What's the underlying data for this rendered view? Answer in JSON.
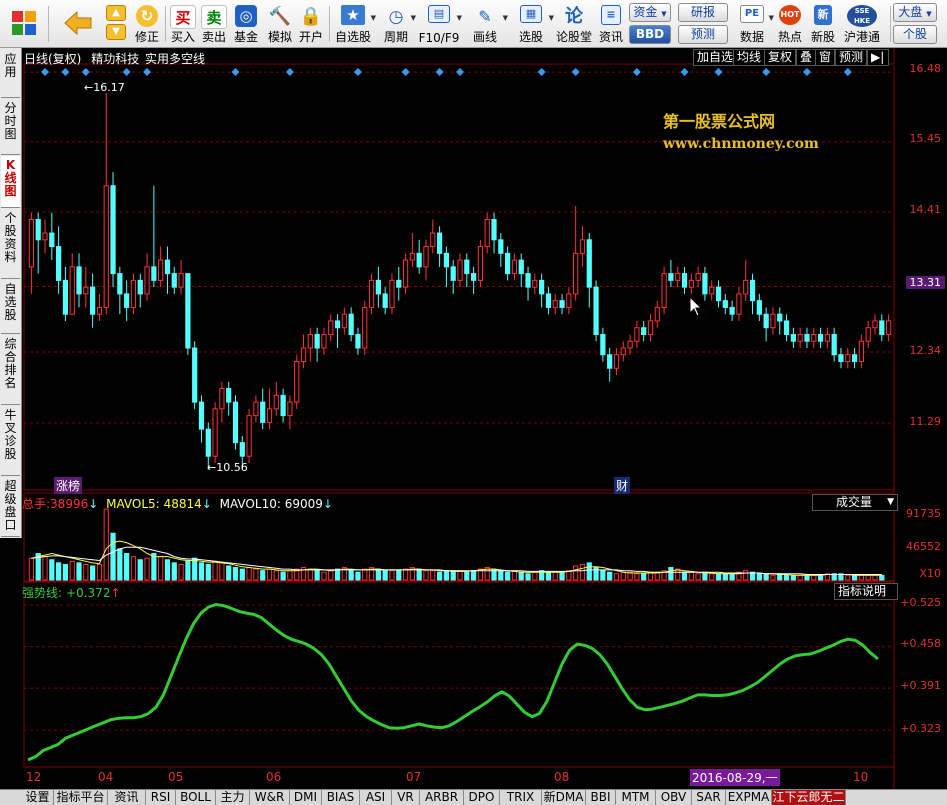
{
  "toolbar": {
    "buttons": [
      {
        "label": "",
        "icon": "app-grid-icon"
      },
      {
        "label": "",
        "icon": "back-arrow-icon"
      },
      {
        "label": "修正",
        "icon": "fix-icon"
      },
      {
        "label": "买入",
        "icon": "buy-icon",
        "glyph": "买"
      },
      {
        "label": "卖出",
        "icon": "sell-icon",
        "glyph": "卖"
      },
      {
        "label": "基金",
        "icon": "fund-icon"
      },
      {
        "label": "模拟",
        "icon": "hammer-icon"
      },
      {
        "label": "开户",
        "icon": "lock-icon"
      },
      {
        "label": "自选股",
        "icon": "star-icon"
      },
      {
        "label": "周期",
        "icon": "clock-icon"
      },
      {
        "label": "F10/F9",
        "icon": "f10-icon"
      },
      {
        "label": "画线",
        "icon": "pen-icon"
      },
      {
        "label": "选股",
        "icon": "screen-icon"
      },
      {
        "label": "论股堂",
        "icon": "forum-icon",
        "glyph": "论"
      },
      {
        "label": "资讯",
        "icon": "news-icon"
      },
      {
        "label": "数据",
        "icon": "pe-icon",
        "glyph": "PE"
      },
      {
        "label": "热点",
        "icon": "hot-icon",
        "glyph": "HOT"
      },
      {
        "label": "新股",
        "icon": "ipo-icon"
      },
      {
        "label": "沪港通",
        "icon": "sse-hke-icon",
        "glyph": "SSE HKE"
      }
    ],
    "small_buttons": {
      "capital": "资金",
      "bbd": "BBD",
      "research": "研报",
      "forecast": "预测",
      "market": "大盘",
      "stock": "个股"
    }
  },
  "left_tabs": [
    "应用",
    "分时图",
    "K线图",
    "个股资料",
    "自选股",
    "综合排名",
    "牛叉诊股",
    "超级盘口"
  ],
  "left_tabs_active": 2,
  "chart_header": {
    "period": "日线(复权)",
    "stock_name": "精功科技",
    "indicator_name": "实用多空线",
    "buttons": [
      "加自选",
      "均线",
      "复权",
      "叠",
      "窗",
      "预测",
      "▶|"
    ]
  },
  "watermark": {
    "line1": "第一股票公式网",
    "line2": "www.chnmoney.com"
  },
  "price_axis": {
    "labels": [
      "16.48",
      "15.45",
      "14.41",
      "13.31",
      "12.34",
      "11.29"
    ],
    "current": "13.31"
  },
  "annotations": {
    "high": "16.17",
    "low": "10.56",
    "tag_left": "涨榜",
    "tag_right": "财"
  },
  "volume_panel": {
    "total_label": "总手:",
    "total_value": "38996",
    "mavol5_label": "MAVOL5:",
    "mavol5_value": "48814",
    "mavol10_label": "MAVOL10:",
    "mavol10_value": "69009",
    "axis": [
      "91735",
      "46552",
      "X10"
    ],
    "dropdown": "成交量"
  },
  "strength_panel": {
    "label": "强势线:",
    "value": "+0.372",
    "axis": [
      "+0.525",
      "+0.458",
      "+0.391",
      "+0.323"
    ],
    "help_button": "指标说明"
  },
  "time_axis": {
    "labels": [
      "12",
      "04",
      "05",
      "06",
      "07",
      "08",
      "10"
    ],
    "cursor": "2016-08-29,一"
  },
  "bottom_tabs": [
    "设置",
    "指标平台",
    "资讯",
    "RSI",
    "BOLL",
    "主力",
    "W&R",
    "DMI",
    "BIAS",
    "ASI",
    "VR",
    "ARBR",
    "DPO",
    "TRIX",
    "新DMA",
    "BBI",
    "MTM",
    "OBV",
    "SAR",
    "EXPMA",
    "江下云郎无二"
  ],
  "colors": {
    "up": "#ff3232",
    "down": "#54ffff",
    "strength": "#33cc33",
    "grid": "#800000",
    "accent": "#e8c020"
  },
  "chart_data": {
    "type": "candlestick",
    "ylim": [
      10.3,
      16.6
    ],
    "candles": [
      [
        13.6,
        14.3,
        14.4,
        13.2
      ],
      [
        14.3,
        14.0,
        14.4,
        13.5
      ],
      [
        14.0,
        14.1,
        14.3,
        13.8
      ],
      [
        14.1,
        13.9,
        14.4,
        13.7
      ],
      [
        13.9,
        13.4,
        14.2,
        13.2
      ],
      [
        13.4,
        12.9,
        13.6,
        12.8
      ],
      [
        12.9,
        13.6,
        13.8,
        12.9
      ],
      [
        13.6,
        13.2,
        13.8,
        13.0
      ],
      [
        13.2,
        13.3,
        13.6,
        13.0
      ],
      [
        13.3,
        12.9,
        13.5,
        12.7
      ],
      [
        12.9,
        13.0,
        13.2,
        12.8
      ],
      [
        13.0,
        14.8,
        16.17,
        12.9
      ],
      [
        14.8,
        13.5,
        15.0,
        13.3
      ],
      [
        13.5,
        13.2,
        13.6,
        12.9
      ],
      [
        13.2,
        13.0,
        13.4,
        12.8
      ],
      [
        13.0,
        13.4,
        13.5,
        12.9
      ],
      [
        13.4,
        13.2,
        13.5,
        13.0
      ],
      [
        13.2,
        13.6,
        13.8,
        13.1
      ],
      [
        13.6,
        13.4,
        14.8,
        13.3
      ],
      [
        13.4,
        13.7,
        13.9,
        13.3
      ],
      [
        13.7,
        13.5,
        13.9,
        13.2
      ],
      [
        13.5,
        13.3,
        13.6,
        13.2
      ],
      [
        13.3,
        13.5,
        13.7,
        13.2
      ],
      [
        13.5,
        12.4,
        13.5,
        12.3
      ],
      [
        12.4,
        11.6,
        12.5,
        11.5
      ],
      [
        11.6,
        11.2,
        11.7,
        11.0
      ],
      [
        11.2,
        10.8,
        11.3,
        10.6
      ],
      [
        10.8,
        11.5,
        11.6,
        10.7
      ],
      [
        11.5,
        11.8,
        11.9,
        11.3
      ],
      [
        11.8,
        11.6,
        11.9,
        11.4
      ],
      [
        11.6,
        11.0,
        11.7,
        10.9
      ],
      [
        11.0,
        10.8,
        11.1,
        10.6
      ],
      [
        10.8,
        11.4,
        11.5,
        10.7
      ],
      [
        11.4,
        11.6,
        11.7,
        11.3
      ],
      [
        11.6,
        11.3,
        11.8,
        11.2
      ],
      [
        11.3,
        11.5,
        11.8,
        11.2
      ],
      [
        11.5,
        11.7,
        11.9,
        11.4
      ],
      [
        11.7,
        11.4,
        11.8,
        11.3
      ],
      [
        11.4,
        11.6,
        11.7,
        11.2
      ],
      [
        11.6,
        12.2,
        12.3,
        11.5
      ],
      [
        12.2,
        12.4,
        12.6,
        12.1
      ],
      [
        12.4,
        12.6,
        12.7,
        12.2
      ],
      [
        12.6,
        12.4,
        12.7,
        12.2
      ],
      [
        12.4,
        12.6,
        12.7,
        12.3
      ],
      [
        12.6,
        12.8,
        12.9,
        12.5
      ],
      [
        12.8,
        12.7,
        12.9,
        12.4
      ],
      [
        12.7,
        12.9,
        13.0,
        12.6
      ],
      [
        12.9,
        12.6,
        13.0,
        12.5
      ],
      [
        12.6,
        12.4,
        12.7,
        12.3
      ],
      [
        12.4,
        13.0,
        13.1,
        12.3
      ],
      [
        13.0,
        13.4,
        13.5,
        12.9
      ],
      [
        13.4,
        13.2,
        13.6,
        13.0
      ],
      [
        13.2,
        13.0,
        13.3,
        12.9
      ],
      [
        13.0,
        13.4,
        13.5,
        12.9
      ],
      [
        13.4,
        13.3,
        13.6,
        13.1
      ],
      [
        13.3,
        13.7,
        13.8,
        13.2
      ],
      [
        13.7,
        13.8,
        14.1,
        13.6
      ],
      [
        13.8,
        13.6,
        14.0,
        13.5
      ],
      [
        13.6,
        13.9,
        14.0,
        13.4
      ],
      [
        13.9,
        14.1,
        14.3,
        13.8
      ],
      [
        14.1,
        13.8,
        14.2,
        13.6
      ],
      [
        13.8,
        13.6,
        13.9,
        13.3
      ],
      [
        13.6,
        13.4,
        13.7,
        13.2
      ],
      [
        13.4,
        13.7,
        13.8,
        13.3
      ],
      [
        13.7,
        13.5,
        13.8,
        13.3
      ],
      [
        13.5,
        13.4,
        13.6,
        13.2
      ],
      [
        13.4,
        13.9,
        14.0,
        13.3
      ],
      [
        13.9,
        14.3,
        14.4,
        13.8
      ],
      [
        14.3,
        14.0,
        14.4,
        13.8
      ],
      [
        14.0,
        13.8,
        14.1,
        13.6
      ],
      [
        13.8,
        13.5,
        13.9,
        13.4
      ],
      [
        13.5,
        13.7,
        13.8,
        13.4
      ],
      [
        13.7,
        13.5,
        13.8,
        13.3
      ],
      [
        13.5,
        13.3,
        13.6,
        13.1
      ],
      [
        13.3,
        13.4,
        13.5,
        13.2
      ],
      [
        13.4,
        13.2,
        13.5,
        13.0
      ],
      [
        13.2,
        13.0,
        13.3,
        12.9
      ],
      [
        13.0,
        13.1,
        13.2,
        12.9
      ],
      [
        13.1,
        13.0,
        13.2,
        12.9
      ],
      [
        13.0,
        13.2,
        13.3,
        12.9
      ],
      [
        13.2,
        13.8,
        14.5,
        13.1
      ],
      [
        13.8,
        14.0,
        14.2,
        13.6
      ],
      [
        14.0,
        13.3,
        14.1,
        13.0
      ],
      [
        13.3,
        12.6,
        13.4,
        12.5
      ],
      [
        12.6,
        12.3,
        12.7,
        12.2
      ],
      [
        12.3,
        12.1,
        12.4,
        11.9
      ],
      [
        12.1,
        12.3,
        12.4,
        12.0
      ],
      [
        12.3,
        12.4,
        12.5,
        12.2
      ],
      [
        12.4,
        12.5,
        12.6,
        12.3
      ],
      [
        12.5,
        12.7,
        12.8,
        12.4
      ],
      [
        12.7,
        12.6,
        12.8,
        12.5
      ],
      [
        12.6,
        12.8,
        12.9,
        12.5
      ],
      [
        12.8,
        13.0,
        13.1,
        12.7
      ],
      [
        13.0,
        13.5,
        13.6,
        12.9
      ],
      [
        13.5,
        13.4,
        13.7,
        13.3
      ],
      [
        13.4,
        13.5,
        13.6,
        13.3
      ],
      [
        13.5,
        13.3,
        13.6,
        13.2
      ],
      [
        13.3,
        13.4,
        13.5,
        13.2
      ],
      [
        13.4,
        13.5,
        13.6,
        13.3
      ],
      [
        13.5,
        13.2,
        13.6,
        13.1
      ],
      [
        13.2,
        13.3,
        13.4,
        13.1
      ],
      [
        13.3,
        13.1,
        13.4,
        13.0
      ],
      [
        13.1,
        13.0,
        13.2,
        12.9
      ],
      [
        13.0,
        12.9,
        13.1,
        12.8
      ],
      [
        12.9,
        13.2,
        13.3,
        12.8
      ],
      [
        13.2,
        13.4,
        13.7,
        13.1
      ],
      [
        13.4,
        13.1,
        13.5,
        12.9
      ],
      [
        13.1,
        12.9,
        13.2,
        12.8
      ],
      [
        12.9,
        12.7,
        13.0,
        12.5
      ],
      [
        12.7,
        12.9,
        13.0,
        12.6
      ],
      [
        12.9,
        12.8,
        13.0,
        12.6
      ],
      [
        12.8,
        12.6,
        12.9,
        12.5
      ],
      [
        12.6,
        12.5,
        12.7,
        12.4
      ],
      [
        12.5,
        12.6,
        12.7,
        12.4
      ],
      [
        12.6,
        12.5,
        12.7,
        12.4
      ],
      [
        12.5,
        12.6,
        12.7,
        12.4
      ],
      [
        12.6,
        12.5,
        12.7,
        12.4
      ],
      [
        12.5,
        12.6,
        12.7,
        12.4
      ],
      [
        12.6,
        12.3,
        12.7,
        12.2
      ],
      [
        12.3,
        12.2,
        12.4,
        12.1
      ],
      [
        12.2,
        12.3,
        12.4,
        12.1
      ],
      [
        12.3,
        12.2,
        12.4,
        12.1
      ],
      [
        12.2,
        12.5,
        12.6,
        12.1
      ],
      [
        12.5,
        12.7,
        12.8,
        12.4
      ],
      [
        12.7,
        12.8,
        12.9,
        12.6
      ],
      [
        12.8,
        12.6,
        12.9,
        12.5
      ],
      [
        12.6,
        12.8,
        12.9,
        12.5
      ]
    ],
    "strength_line": [
      0.275,
      0.28,
      0.29,
      0.295,
      0.3,
      0.31,
      0.315,
      0.32,
      0.325,
      0.33,
      0.335,
      0.34,
      0.342,
      0.343,
      0.343,
      0.345,
      0.35,
      0.36,
      0.38,
      0.41,
      0.44,
      0.47,
      0.495,
      0.512,
      0.522,
      0.526,
      0.524,
      0.52,
      0.515,
      0.512,
      0.51,
      0.505,
      0.495,
      0.485,
      0.476,
      0.47,
      0.466,
      0.462,
      0.455,
      0.445,
      0.43,
      0.41,
      0.39,
      0.37,
      0.355,
      0.345,
      0.338,
      0.332,
      0.327,
      0.326,
      0.327,
      0.33,
      0.333,
      0.33,
      0.328,
      0.327,
      0.33,
      0.337,
      0.345,
      0.353,
      0.36,
      0.368,
      0.378,
      0.385,
      0.378,
      0.365,
      0.352,
      0.345,
      0.35,
      0.37,
      0.4,
      0.43,
      0.452,
      0.462,
      0.46,
      0.455,
      0.445,
      0.43,
      0.41,
      0.39,
      0.372,
      0.36,
      0.356,
      0.357,
      0.36,
      0.363,
      0.366,
      0.37,
      0.375,
      0.38,
      0.38,
      0.379,
      0.379,
      0.38,
      0.383,
      0.387,
      0.393,
      0.4,
      0.41,
      0.42,
      0.43,
      0.438,
      0.443,
      0.445,
      0.446,
      0.45,
      0.455,
      0.46,
      0.466,
      0.47,
      0.468,
      0.46,
      0.448,
      0.438
    ],
    "volumes": [
      28,
      34,
      30,
      26,
      22,
      20,
      24,
      22,
      20,
      18,
      20,
      91,
      60,
      40,
      34,
      30,
      26,
      28,
      34,
      30,
      26,
      22,
      20,
      24,
      28,
      22,
      20,
      24,
      22,
      18,
      16,
      14,
      16,
      14,
      12,
      14,
      12,
      10,
      12,
      14,
      16,
      14,
      12,
      10,
      12,
      14,
      16,
      12,
      10,
      14,
      16,
      14,
      12,
      12,
      12,
      14,
      16,
      14,
      12,
      12,
      10,
      12,
      12,
      12,
      10,
      12,
      14,
      16,
      14,
      12,
      10,
      12,
      10,
      8,
      10,
      12,
      10,
      10,
      10,
      12,
      18,
      20,
      22,
      16,
      12,
      10,
      8,
      10,
      10,
      8,
      8,
      10,
      10,
      12,
      16,
      14,
      10,
      10,
      8,
      10,
      8,
      8,
      8,
      8,
      10,
      12,
      10,
      8,
      8,
      6,
      8,
      6,
      6,
      6,
      6,
      6,
      6,
      8,
      8,
      8,
      6,
      6,
      6,
      6,
      6,
      6
    ],
    "mavol5": [
      28,
      30,
      32,
      34,
      32,
      30,
      28,
      26,
      24,
      22,
      21,
      40,
      48,
      50,
      48,
      44,
      40,
      34,
      30,
      30,
      30,
      28,
      26,
      25,
      25,
      24,
      23,
      23,
      22,
      21,
      19,
      17,
      16,
      15,
      14,
      14,
      13,
      12,
      12,
      12,
      13,
      14,
      14,
      13,
      12,
      13,
      14,
      14,
      13,
      13,
      14,
      14,
      13,
      13,
      13,
      13,
      14,
      14,
      13,
      13,
      12,
      12,
      11,
      11,
      11,
      12,
      13,
      14,
      14,
      13,
      12,
      11,
      10,
      10,
      10,
      10,
      10,
      10,
      10,
      11,
      13,
      15,
      17,
      17,
      16,
      14,
      12,
      10,
      9,
      9,
      9,
      9,
      9,
      10,
      12,
      13,
      12,
      11,
      10,
      9,
      9,
      8,
      8,
      8,
      8,
      9,
      9,
      9,
      8,
      8,
      7,
      7,
      6,
      6,
      6,
      6,
      6,
      7,
      7,
      7,
      7,
      6,
      6,
      6,
      6,
      6
    ],
    "mavol10": [
      28,
      29,
      30,
      31,
      31,
      30,
      29,
      28,
      27,
      26,
      25,
      32,
      36,
      40,
      42,
      42,
      42,
      40,
      38,
      36,
      34,
      30,
      28,
      27,
      27,
      26,
      25,
      24,
      23,
      22,
      21,
      20,
      19,
      18,
      17,
      16,
      15,
      14,
      14,
      13,
      13,
      13,
      13,
      13,
      13,
      13,
      13,
      13,
      13,
      13,
      13,
      13,
      13,
      13,
      13,
      13,
      13,
      13,
      13,
      13,
      13,
      12,
      12,
      12,
      12,
      12,
      12,
      12,
      12,
      12,
      12,
      12,
      12,
      11,
      11,
      11,
      11,
      11,
      11,
      11,
      12,
      12,
      13,
      13,
      13,
      13,
      13,
      12,
      12,
      11,
      11,
      10,
      10,
      10,
      10,
      10,
      10,
      10,
      10,
      10,
      10,
      10,
      9,
      9,
      9,
      9,
      9,
      9,
      8,
      8,
      8,
      8,
      8,
      8,
      7,
      7,
      7,
      7,
      7,
      7,
      7,
      7,
      7,
      7,
      7,
      7
    ]
  }
}
